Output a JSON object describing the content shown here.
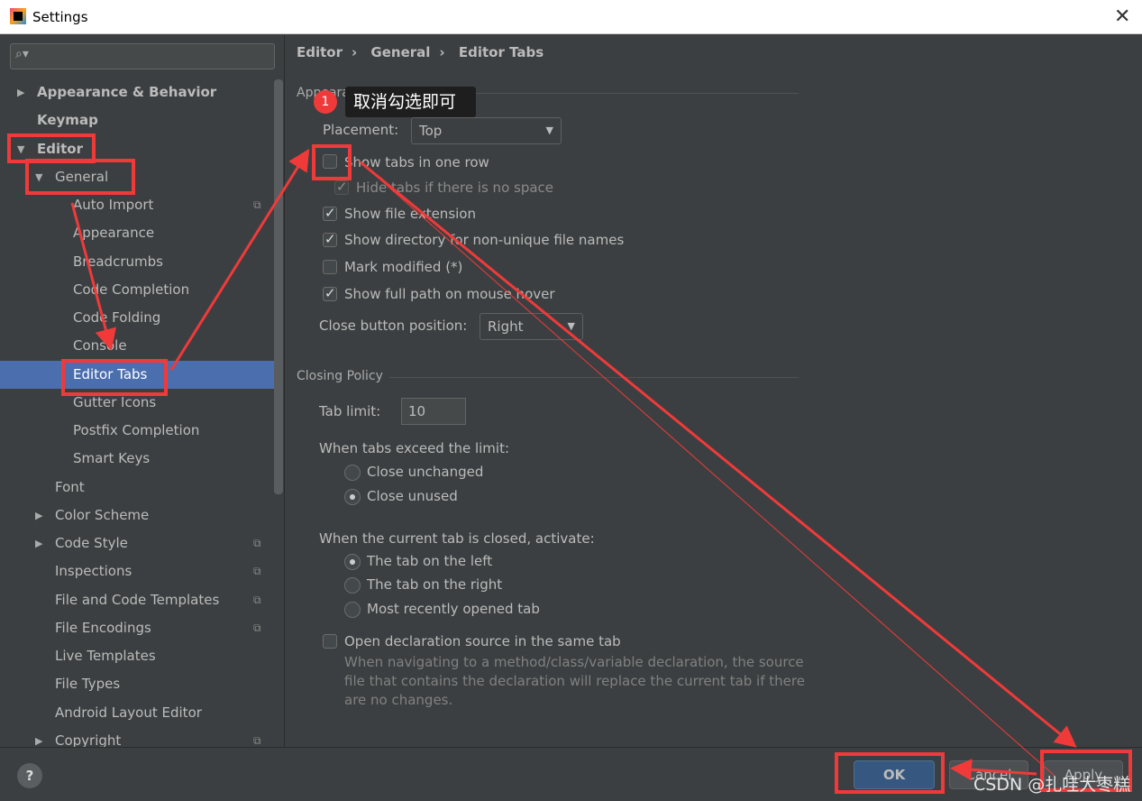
{
  "window": {
    "title": "Settings"
  },
  "search": {
    "placeholder": "",
    "icon": "search-icon"
  },
  "tree": [
    {
      "label": "Appearance & Behavior",
      "level": 0,
      "arrow": "▶",
      "bold": true
    },
    {
      "label": "Keymap",
      "level": 0,
      "arrow": "",
      "bold": true
    },
    {
      "label": "Editor",
      "level": 0,
      "arrow": "▼",
      "bold": true
    },
    {
      "label": "General",
      "level": 1,
      "arrow": "▼"
    },
    {
      "label": "Auto Import",
      "level": 2,
      "copy": true
    },
    {
      "label": "Appearance",
      "level": 2
    },
    {
      "label": "Breadcrumbs",
      "level": 2
    },
    {
      "label": "Code Completion",
      "level": 2
    },
    {
      "label": "Code Folding",
      "level": 2
    },
    {
      "label": "Console",
      "level": 2
    },
    {
      "label": "Editor Tabs",
      "level": 2,
      "selected": true
    },
    {
      "label": "Gutter Icons",
      "level": 2
    },
    {
      "label": "Postfix Completion",
      "level": 2
    },
    {
      "label": "Smart Keys",
      "level": 2
    },
    {
      "label": "Font",
      "level": 1
    },
    {
      "label": "Color Scheme",
      "level": 1,
      "arrow": "▶"
    },
    {
      "label": "Code Style",
      "level": 1,
      "arrow": "▶",
      "copy": true
    },
    {
      "label": "Inspections",
      "level": 1,
      "copy": true
    },
    {
      "label": "File and Code Templates",
      "level": 1,
      "copy": true
    },
    {
      "label": "File Encodings",
      "level": 1,
      "copy": true
    },
    {
      "label": "Live Templates",
      "level": 1
    },
    {
      "label": "File Types",
      "level": 1
    },
    {
      "label": "Android Layout Editor",
      "level": 1
    },
    {
      "label": "Copyright",
      "level": 1,
      "arrow": "▶",
      "copy": true
    }
  ],
  "breadcrumb": [
    "Editor",
    "General",
    "Editor Tabs"
  ],
  "appearance": {
    "title": "Appearance",
    "placement_label": "Placement:",
    "placement_value": "Top",
    "show_one_row": {
      "label": "Show tabs in one row",
      "checked": false
    },
    "hide_no_space": {
      "label": "Hide tabs if there is no space",
      "checked": true,
      "disabled": true
    },
    "show_ext": {
      "label": "Show file extension",
      "checked": true
    },
    "show_dir": {
      "label": "Show directory for non-unique file names",
      "checked": true
    },
    "mark_mod": {
      "label": "Mark modified (*)",
      "checked": false
    },
    "full_path": {
      "label": "Show full path on mouse hover",
      "checked": true
    },
    "close_pos_label": "Close button position:",
    "close_pos_value": "Right"
  },
  "closing": {
    "title": "Closing Policy",
    "tab_limit_label": "Tab limit:",
    "tab_limit_value": "10",
    "exceed_label": "When tabs exceed the limit:",
    "close_unchanged": "Close unchanged",
    "close_unused": "Close unused",
    "activate_label": "When the current tab is closed, activate:",
    "left": "The tab on the left",
    "right": "The tab on the right",
    "recent": "Most recently opened tab",
    "open_decl": {
      "label": "Open declaration source in the same tab",
      "checked": false
    },
    "desc1": "When navigating to a method/class/variable declaration, the source",
    "desc2": "file that contains the declaration will replace the current tab if there",
    "desc3": "are no changes."
  },
  "buttons": {
    "ok": "OK",
    "cancel": "Cancel",
    "apply": "Apply",
    "help": "?"
  },
  "annotation": {
    "badge": "1",
    "tooltip": "取消勾选即可",
    "color": "#f03a3a"
  },
  "watermark": "CSDN @扎哇大枣糕"
}
